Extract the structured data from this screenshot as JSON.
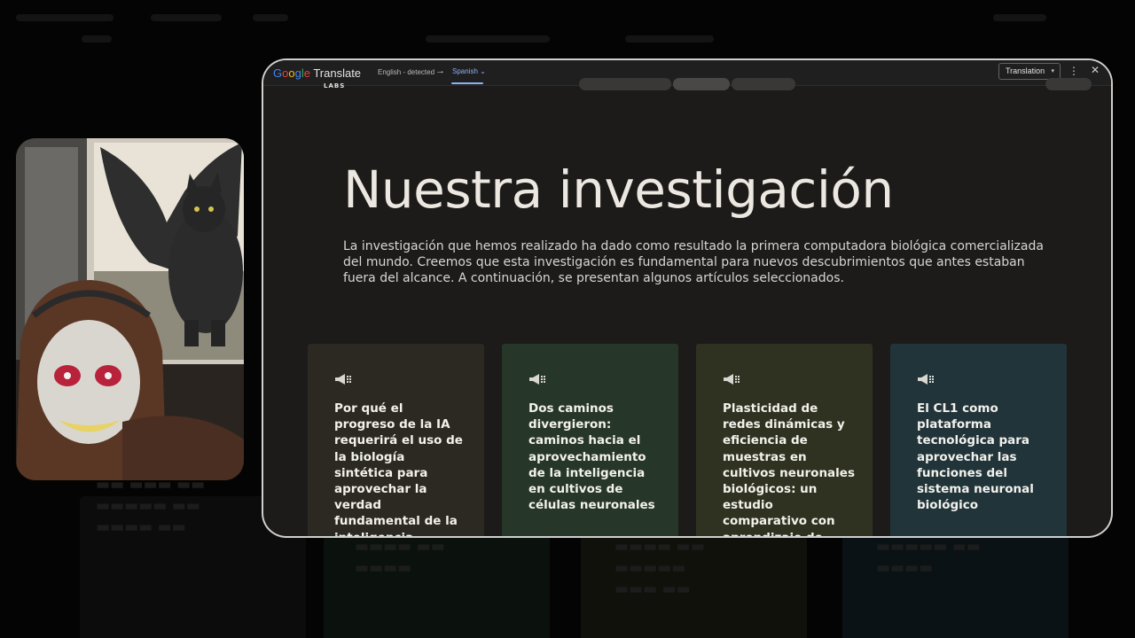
{
  "translate_bar": {
    "brand": "Google Translate",
    "source_language": "English - detected",
    "arrow": "→",
    "target_language": "Spanish",
    "target_caret": "⌄",
    "mode_select": "Translation",
    "select_caret": "▾",
    "more_glyph": "⋮",
    "close_glyph": "✕",
    "accent_color": "#8ab4f8"
  },
  "page": {
    "logo_text": "LABS",
    "title": "Nuestra investigación",
    "intro": "La investigación que hemos realizado ha dado como resultado la primera computadora biológica comercializada del mundo. Creemos que esta investigación es fundamental para nuevos descubrimientos que antes estaban fuera del alcance. A continuación, se presentan algunos artículos seleccionados.",
    "cards": [
      {
        "title": "Por qué el progreso de la IA requerirá el uso de la biología sintética para aprovechar la verdad fundamental de la inteligencia",
        "bg_color": "#2b2922",
        "icon": "megaphone-icon"
      },
      {
        "title": "Dos caminos divergieron: caminos hacia el aprovechamiento de la inteligencia en cultivos de células neuronales",
        "bg_color": "#263628",
        "icon": "megaphone-icon"
      },
      {
        "title": "Plasticidad de redes dinámicas y eficiencia de muestras en cultivos neuronales biológicos: un estudio comparativo con aprendizaje de refuerzo profundo",
        "bg_color": "#2f3220",
        "icon": "megaphone-icon"
      },
      {
        "title": "El CL1 como plataforma tecnológica para aprovechar las funciones del sistema neuronal biológico",
        "bg_color": "#21343a",
        "icon": "megaphone-icon"
      }
    ]
  },
  "webcam": {
    "icon": "webcam-feed"
  }
}
